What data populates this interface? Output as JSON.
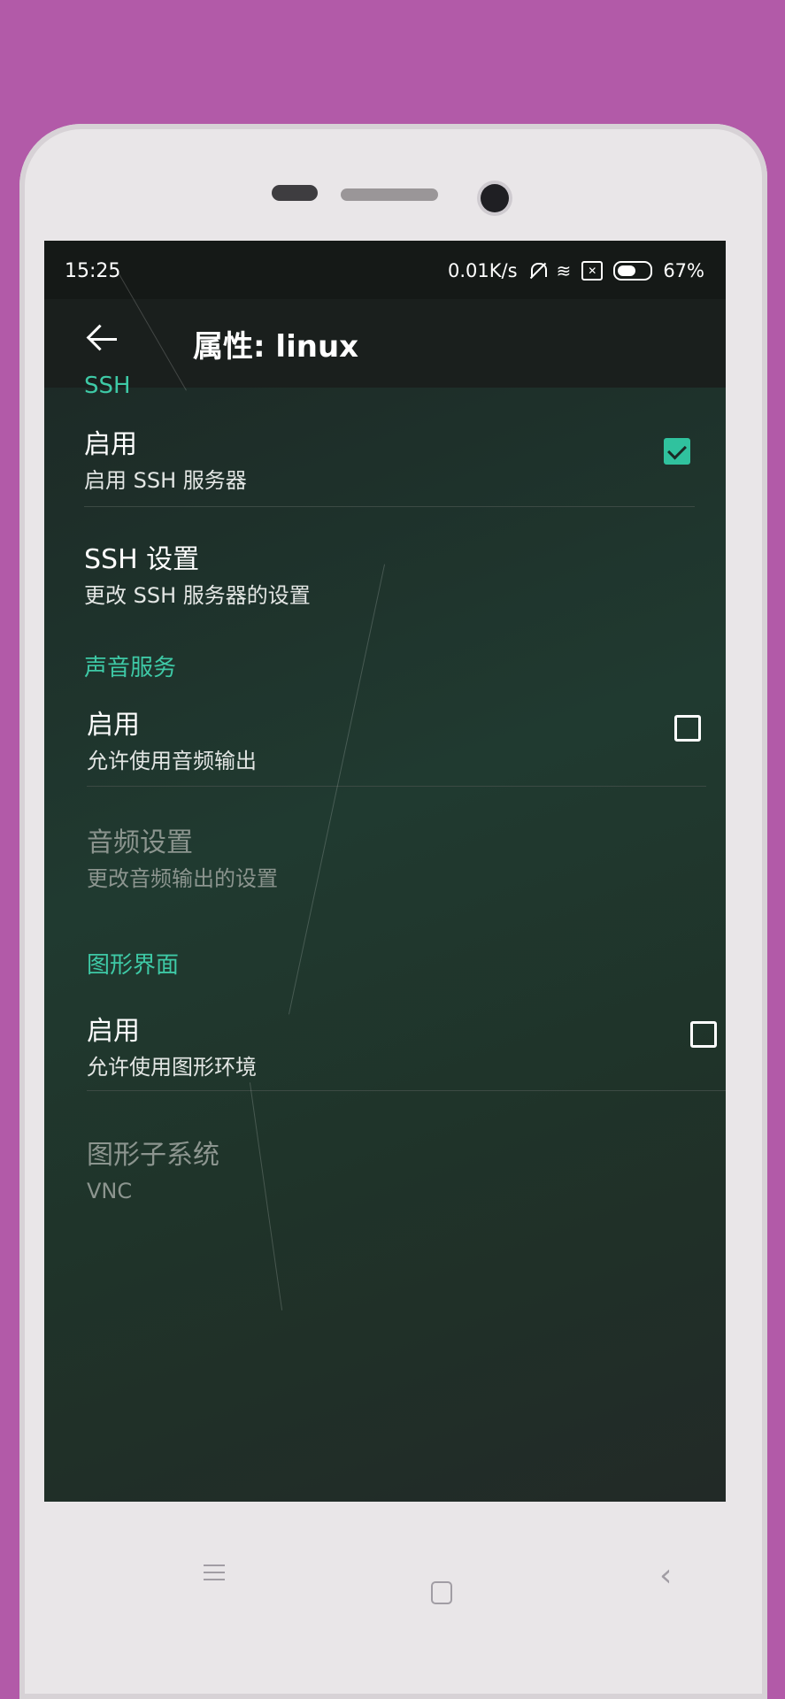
{
  "status": {
    "time": "15:25",
    "net_speed": "0.01K/s",
    "battery": "67%",
    "battery_level": 0.67,
    "icons": [
      "bell-muted-icon",
      "wifi-icon",
      "sim-icon",
      "battery-icon"
    ]
  },
  "appbar": {
    "title": "属性: linux",
    "back_icon": "arrow-left-icon"
  },
  "sections": [
    {
      "header": "SSH",
      "items": [
        {
          "title": "启用",
          "subtitle": "启用 SSH 服务器",
          "checkbox": true,
          "checked": true,
          "enabled": true
        },
        {
          "title": "SSH 设置",
          "subtitle": "更改 SSH 服务器的设置",
          "checkbox": false,
          "enabled": true
        }
      ]
    },
    {
      "header": "声音服务",
      "items": [
        {
          "title": "启用",
          "subtitle": "允许使用音频输出",
          "checkbox": true,
          "checked": false,
          "enabled": true
        },
        {
          "title": "音频设置",
          "subtitle": "更改音频输出的设置",
          "checkbox": false,
          "enabled": false
        }
      ]
    },
    {
      "header": "图形界面",
      "items": [
        {
          "title": "启用",
          "subtitle": "允许使用图形环境",
          "checkbox": true,
          "checked": false,
          "enabled": true
        },
        {
          "title": "图形子系统",
          "subtitle": "VNC",
          "checkbox": false,
          "enabled": false
        }
      ]
    }
  ],
  "colors": {
    "accent": "#3ec9a6",
    "background": "#1f3329",
    "text": "#ffffff",
    "disabled_text": "#8c958f"
  },
  "nav_keys": [
    "menu-icon",
    "home-icon",
    "back-icon"
  ]
}
